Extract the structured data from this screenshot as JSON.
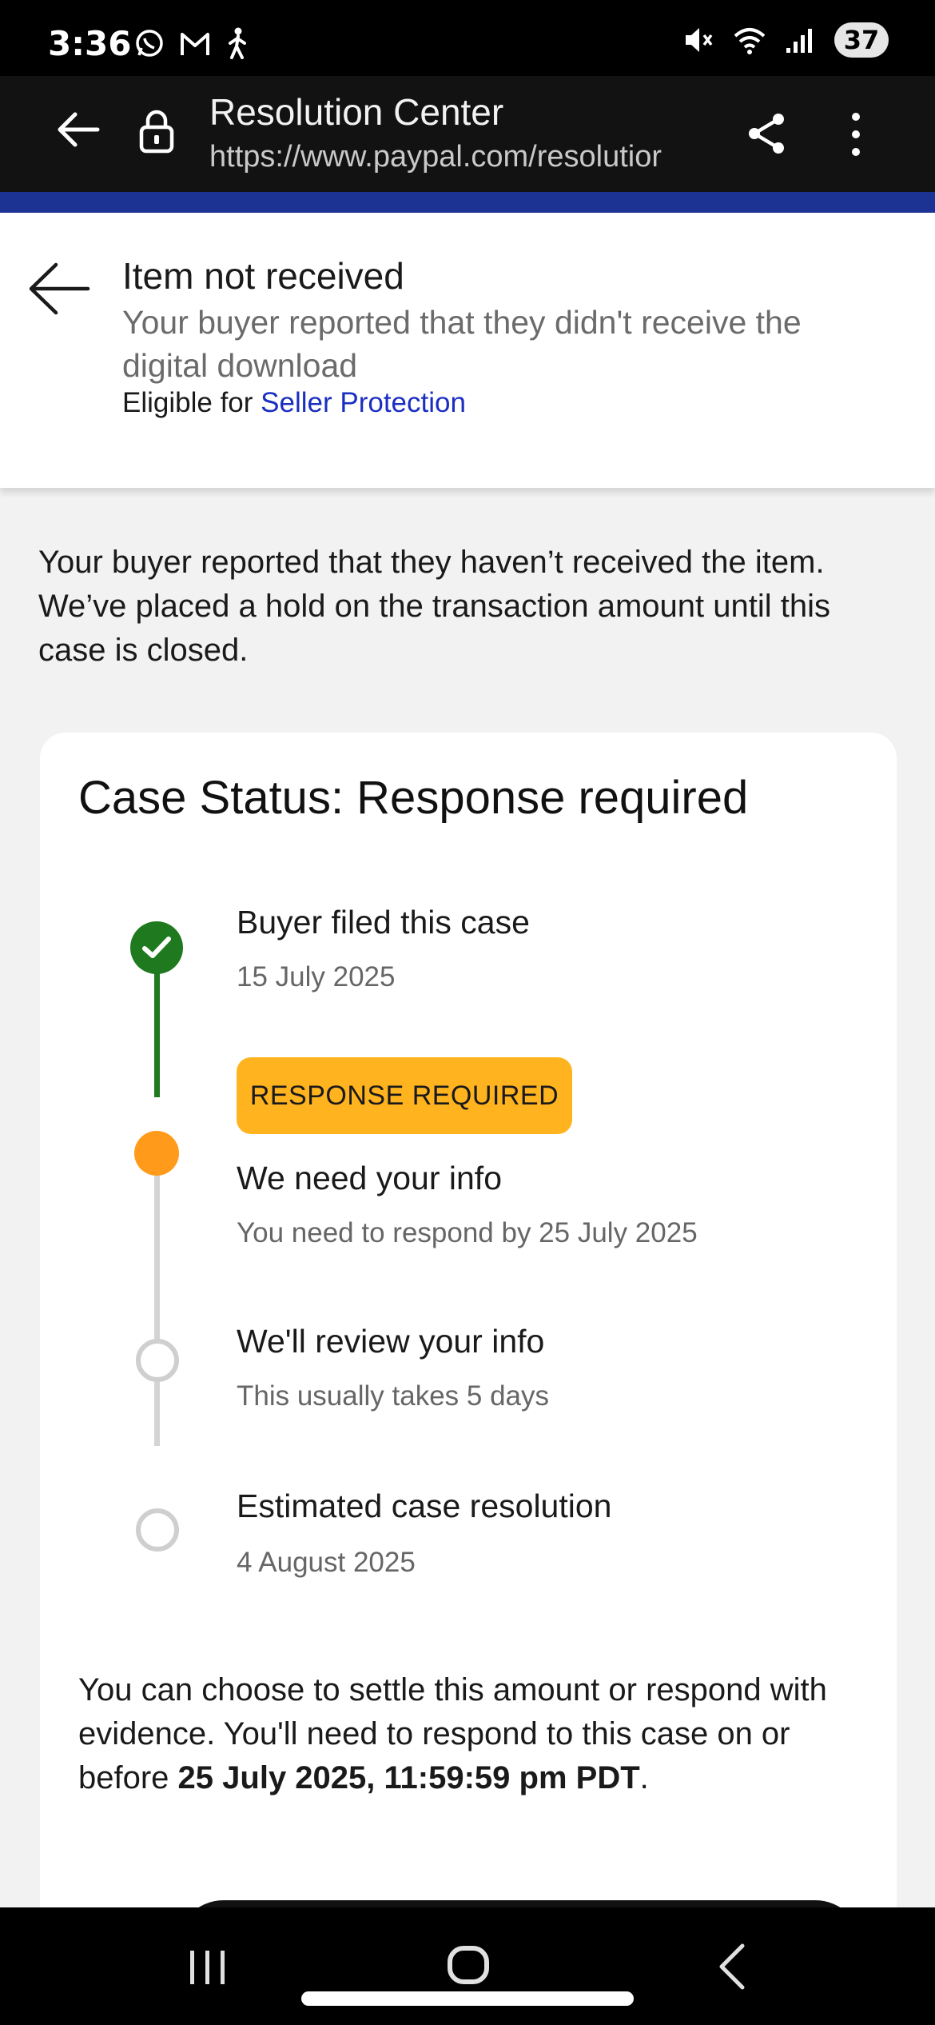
{
  "status_bar": {
    "time": "3:36",
    "battery": "37"
  },
  "browser": {
    "title": "Resolution Center",
    "url": "https://www.paypal.com/resolutior"
  },
  "header": {
    "title": "Item not received",
    "subtitle": "Your buyer reported that they didn't receive the digital download",
    "eligible_prefix": "Eligible for",
    "seller_protection": "Seller Protection"
  },
  "intro_text": "Your buyer reported that they haven’t received the item. We’ve placed a hold on the transaction amount until this case is closed.",
  "case": {
    "title": "Case Status: Response required",
    "badge": "RESPONSE REQUIRED",
    "steps": [
      {
        "title": "Buyer filed this case",
        "sub": "15 July 2025",
        "state": "done"
      },
      {
        "title": "We need your info",
        "sub": "You need to respond by 25 July 2025",
        "state": "current"
      },
      {
        "title": "We'll review your info",
        "sub": "This usually takes 5 days",
        "state": "pending"
      },
      {
        "title": "Estimated case resolution",
        "sub": "4 August 2025",
        "state": "pending"
      }
    ],
    "footer_text": "You can choose to settle this amount or respond with evidence. You'll need to respond to this case on or before",
    "footer_deadline": "25 July 2025, 11:59:59 pm PDT",
    "footer_end": "."
  },
  "colors": {
    "brand_stripe": "#1d3394",
    "done": "#1f7a1f",
    "current": "#ff9a1a",
    "badge": "#ffb31f",
    "link": "#1a2ec0"
  }
}
